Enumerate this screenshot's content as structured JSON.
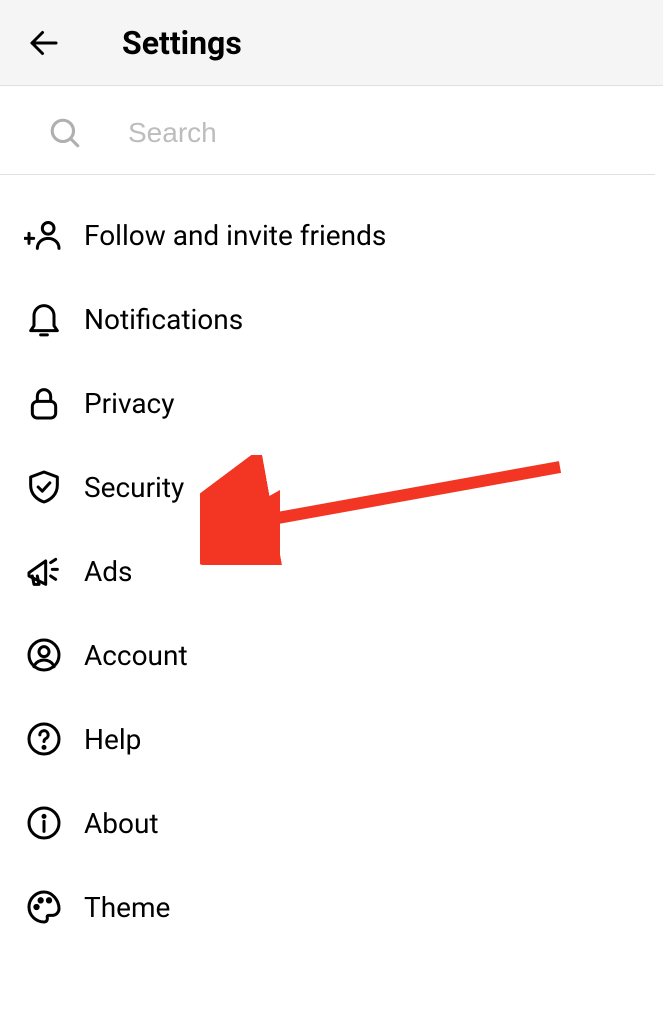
{
  "header": {
    "title": "Settings"
  },
  "search": {
    "placeholder": "Search"
  },
  "menu": {
    "items": [
      {
        "label": "Follow and invite friends"
      },
      {
        "label": "Notifications"
      },
      {
        "label": "Privacy"
      },
      {
        "label": "Security"
      },
      {
        "label": "Ads"
      },
      {
        "label": "Account"
      },
      {
        "label": "Help"
      },
      {
        "label": "About"
      },
      {
        "label": "Theme"
      }
    ]
  },
  "annotation": {
    "arrow_color": "#f33523"
  }
}
